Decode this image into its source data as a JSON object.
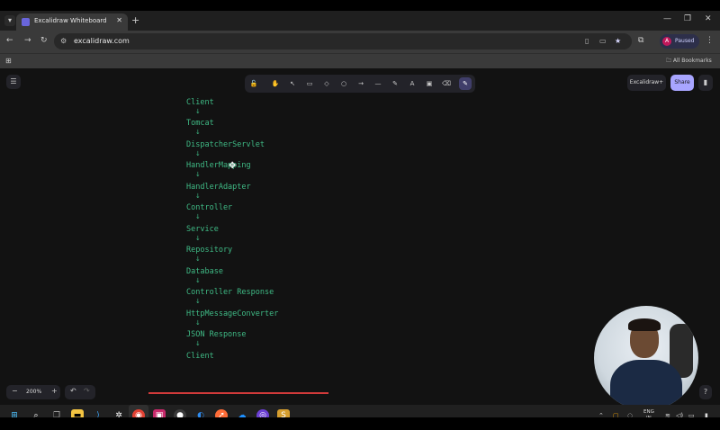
{
  "browser": {
    "tab_title": "Excalidraw Whiteboard",
    "tab_close": "✕",
    "new_tab": "+",
    "window_controls": [
      "—",
      "❐",
      "✕"
    ],
    "url": "excalidraw.com",
    "profile_initial": "A",
    "profile_status": "Paused",
    "bookmarks_label": "All Bookmarks"
  },
  "excalidraw": {
    "library_button": "Excalidraw+",
    "share_button": "Share",
    "zoom": "200%",
    "zoom_minus": "−",
    "zoom_plus": "+",
    "flow": [
      "Client",
      "Tomcat",
      "DispatcherServlet",
      "HandlerMapping",
      "HandlerAdapter",
      "Controller",
      "Service",
      "Repository",
      "Database",
      "Controller Response",
      "HttpMessageConverter",
      "JSON Response",
      "Client"
    ],
    "arrow_glyph": "↓",
    "accent_color": "#3fba85",
    "share_color": "#a8a5ff"
  },
  "taskbar": {
    "lang_line1": "ENG",
    "lang_line2": "IN"
  }
}
